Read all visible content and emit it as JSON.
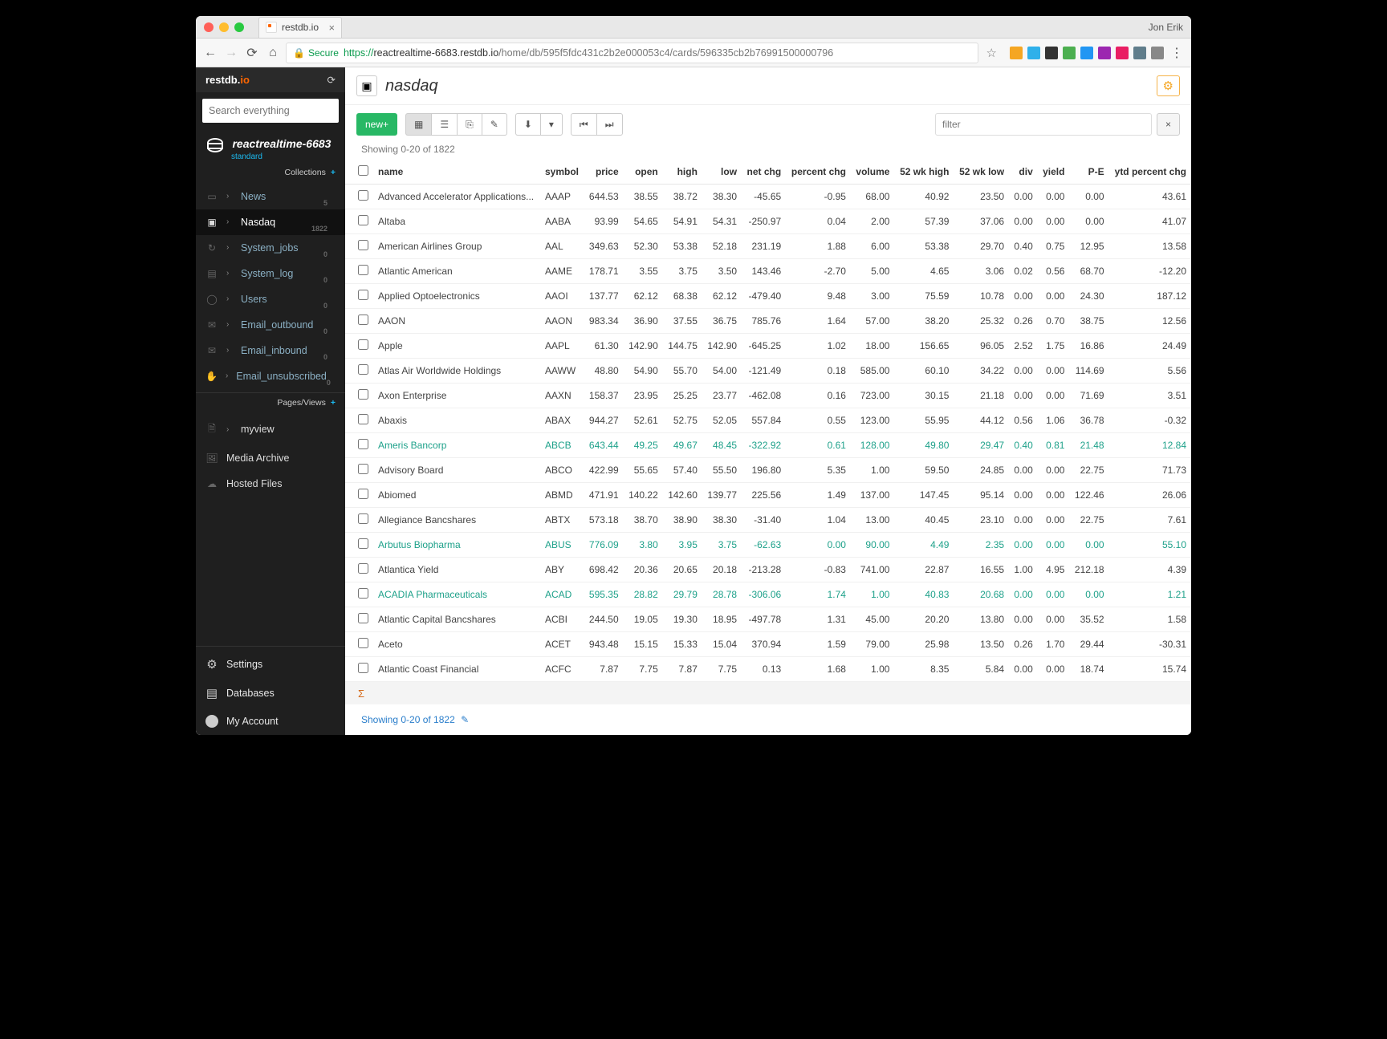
{
  "chrome": {
    "tab_title": "restdb.io",
    "user": "Jon Erik",
    "secure_label": "Secure",
    "https": "https://",
    "host": "reactrealtime-6683.restdb.io",
    "path": "/home/db/595f5fdc431c2b2e000053c4/cards/596335cb2b76991500000796",
    "ext_colors": [
      "#f5a623",
      "#2fb0ea",
      "#333",
      "#4caf50",
      "#2196f3",
      "#9c27b0",
      "#e91e63",
      "#607d8b",
      "#888"
    ]
  },
  "sidebar": {
    "logo_main": "restdb.io",
    "search_placeholder": "Search everything",
    "db_name": "reactrealtime-6683",
    "db_sub": "standard",
    "collections_label": "Collections",
    "pages_label": "Pages/Views",
    "items": [
      {
        "label": "News",
        "count": "5"
      },
      {
        "label": "Nasdaq",
        "count": "1822"
      },
      {
        "label": "System_jobs",
        "count": "0"
      },
      {
        "label": "System_log",
        "count": "0"
      },
      {
        "label": "Users",
        "count": "0"
      },
      {
        "label": "Email_outbound",
        "count": "0"
      },
      {
        "label": "Email_inbound",
        "count": "0"
      },
      {
        "label": "Email_unsubscribed",
        "count": "0"
      }
    ],
    "myview_label": "myview",
    "media_label": "Media Archive",
    "hosted_label": "Hosted Files",
    "settings_label": "Settings",
    "databases_label": "Databases",
    "account_label": "My Account"
  },
  "main": {
    "title": "nasdaq",
    "new_label": "new",
    "filter_placeholder": "filter",
    "showing_label": "Showing 0-20 of 1822",
    "foot_showing": "Showing 0-20 of 1822",
    "columns": [
      "name",
      "symbol",
      "price",
      "open",
      "high",
      "low",
      "net chg",
      "percent chg",
      "volume",
      "52 wk high",
      "52 wk low",
      "div",
      "yield",
      "P-E",
      "ytd percent chg"
    ],
    "rows": [
      {
        "hl": false,
        "name": "Advanced Accelerator Applications...",
        "symbol": "AAAP",
        "price": "644.53",
        "open": "38.55",
        "high": "38.72",
        "low": "38.30",
        "net_chg": "-45.65",
        "percent_chg": "-0.95",
        "volume": "68.00",
        "wk_high": "40.92",
        "wk_low": "23.50",
        "div": "0.00",
        "yield": "0.00",
        "pe": "0.00",
        "ytd": "43.61"
      },
      {
        "hl": false,
        "name": "Altaba",
        "symbol": "AABA",
        "price": "93.99",
        "open": "54.65",
        "high": "54.91",
        "low": "54.31",
        "net_chg": "-250.97",
        "percent_chg": "0.04",
        "volume": "2.00",
        "wk_high": "57.39",
        "wk_low": "37.06",
        "div": "0.00",
        "yield": "0.00",
        "pe": "0.00",
        "ytd": "41.07"
      },
      {
        "hl": false,
        "name": "American Airlines Group",
        "symbol": "AAL",
        "price": "349.63",
        "open": "52.30",
        "high": "53.38",
        "low": "52.18",
        "net_chg": "231.19",
        "percent_chg": "1.88",
        "volume": "6.00",
        "wk_high": "53.38",
        "wk_low": "29.70",
        "div": "0.40",
        "yield": "0.75",
        "pe": "12.95",
        "ytd": "13.58"
      },
      {
        "hl": false,
        "name": "Atlantic American",
        "symbol": "AAME",
        "price": "178.71",
        "open": "3.55",
        "high": "3.75",
        "low": "3.50",
        "net_chg": "143.46",
        "percent_chg": "-2.70",
        "volume": "5.00",
        "wk_high": "4.65",
        "wk_low": "3.06",
        "div": "0.02",
        "yield": "0.56",
        "pe": "68.70",
        "ytd": "-12.20"
      },
      {
        "hl": false,
        "name": "Applied Optoelectronics",
        "symbol": "AAOI",
        "price": "137.77",
        "open": "62.12",
        "high": "68.38",
        "low": "62.12",
        "net_chg": "-479.40",
        "percent_chg": "9.48",
        "volume": "3.00",
        "wk_high": "75.59",
        "wk_low": "10.78",
        "div": "0.00",
        "yield": "0.00",
        "pe": "24.30",
        "ytd": "187.12"
      },
      {
        "hl": false,
        "name": "AAON",
        "symbol": "AAON",
        "price": "983.34",
        "open": "36.90",
        "high": "37.55",
        "low": "36.75",
        "net_chg": "785.76",
        "percent_chg": "1.64",
        "volume": "57.00",
        "wk_high": "38.20",
        "wk_low": "25.32",
        "div": "0.26",
        "yield": "0.70",
        "pe": "38.75",
        "ytd": "12.56"
      },
      {
        "hl": false,
        "name": "Apple",
        "symbol": "AAPL",
        "price": "61.30",
        "open": "142.90",
        "high": "144.75",
        "low": "142.90",
        "net_chg": "-645.25",
        "percent_chg": "1.02",
        "volume": "18.00",
        "wk_high": "156.65",
        "wk_low": "96.05",
        "div": "2.52",
        "yield": "1.75",
        "pe": "16.86",
        "ytd": "24.49"
      },
      {
        "hl": false,
        "name": "Atlas Air Worldwide Holdings",
        "symbol": "AAWW",
        "price": "48.80",
        "open": "54.90",
        "high": "55.70",
        "low": "54.00",
        "net_chg": "-121.49",
        "percent_chg": "0.18",
        "volume": "585.00",
        "wk_high": "60.10",
        "wk_low": "34.22",
        "div": "0.00",
        "yield": "0.00",
        "pe": "114.69",
        "ytd": "5.56"
      },
      {
        "hl": false,
        "name": "Axon Enterprise",
        "symbol": "AAXN",
        "price": "158.37",
        "open": "23.95",
        "high": "25.25",
        "low": "23.77",
        "net_chg": "-462.08",
        "percent_chg": "0.16",
        "volume": "723.00",
        "wk_high": "30.15",
        "wk_low": "21.18",
        "div": "0.00",
        "yield": "0.00",
        "pe": "71.69",
        "ytd": "3.51"
      },
      {
        "hl": false,
        "name": "Abaxis",
        "symbol": "ABAX",
        "price": "944.27",
        "open": "52.61",
        "high": "52.75",
        "low": "52.05",
        "net_chg": "557.84",
        "percent_chg": "0.55",
        "volume": "123.00",
        "wk_high": "55.95",
        "wk_low": "44.12",
        "div": "0.56",
        "yield": "1.06",
        "pe": "36.78",
        "ytd": "-0.32"
      },
      {
        "hl": true,
        "name": "Ameris Bancorp",
        "symbol": "ABCB",
        "price": "643.44",
        "open": "49.25",
        "high": "49.67",
        "low": "48.45",
        "net_chg": "-322.92",
        "percent_chg": "0.61",
        "volume": "128.00",
        "wk_high": "49.80",
        "wk_low": "29.47",
        "div": "0.40",
        "yield": "0.81",
        "pe": "21.48",
        "ytd": "12.84"
      },
      {
        "hl": false,
        "name": "Advisory Board",
        "symbol": "ABCO",
        "price": "422.99",
        "open": "55.65",
        "high": "57.40",
        "low": "55.50",
        "net_chg": "196.80",
        "percent_chg": "5.35",
        "volume": "1.00",
        "wk_high": "59.50",
        "wk_low": "24.85",
        "div": "0.00",
        "yield": "0.00",
        "pe": "22.75",
        "ytd": "71.73"
      },
      {
        "hl": false,
        "name": "Abiomed",
        "symbol": "ABMD",
        "price": "471.91",
        "open": "140.22",
        "high": "142.60",
        "low": "139.77",
        "net_chg": "225.56",
        "percent_chg": "1.49",
        "volume": "137.00",
        "wk_high": "147.45",
        "wk_low": "95.14",
        "div": "0.00",
        "yield": "0.00",
        "pe": "122.46",
        "ytd": "26.06"
      },
      {
        "hl": false,
        "name": "Allegiance Bancshares",
        "symbol": "ABTX",
        "price": "573.18",
        "open": "38.70",
        "high": "38.90",
        "low": "38.30",
        "net_chg": "-31.40",
        "percent_chg": "1.04",
        "volume": "13.00",
        "wk_high": "40.45",
        "wk_low": "23.10",
        "div": "0.00",
        "yield": "0.00",
        "pe": "22.75",
        "ytd": "7.61"
      },
      {
        "hl": true,
        "name": "Arbutus Biopharma",
        "symbol": "ABUS",
        "price": "776.09",
        "open": "3.80",
        "high": "3.95",
        "low": "3.75",
        "net_chg": "-62.63",
        "percent_chg": "0.00",
        "volume": "90.00",
        "wk_high": "4.49",
        "wk_low": "2.35",
        "div": "0.00",
        "yield": "0.00",
        "pe": "0.00",
        "ytd": "55.10"
      },
      {
        "hl": false,
        "name": "Atlantica Yield",
        "symbol": "ABY",
        "price": "698.42",
        "open": "20.36",
        "high": "20.65",
        "low": "20.18",
        "net_chg": "-213.28",
        "percent_chg": "-0.83",
        "volume": "741.00",
        "wk_high": "22.87",
        "wk_low": "16.55",
        "div": "1.00",
        "yield": "4.95",
        "pe": "212.18",
        "ytd": "4.39"
      },
      {
        "hl": true,
        "name": "ACADIA Pharmaceuticals",
        "symbol": "ACAD",
        "price": "595.35",
        "open": "28.82",
        "high": "29.79",
        "low": "28.78",
        "net_chg": "-306.06",
        "percent_chg": "1.74",
        "volume": "1.00",
        "wk_high": "40.83",
        "wk_low": "20.68",
        "div": "0.00",
        "yield": "0.00",
        "pe": "0.00",
        "ytd": "1.21"
      },
      {
        "hl": false,
        "name": "Atlantic Capital Bancshares",
        "symbol": "ACBI",
        "price": "244.50",
        "open": "19.05",
        "high": "19.30",
        "low": "18.95",
        "net_chg": "-497.78",
        "percent_chg": "1.31",
        "volume": "45.00",
        "wk_high": "20.20",
        "wk_low": "13.80",
        "div": "0.00",
        "yield": "0.00",
        "pe": "35.52",
        "ytd": "1.58"
      },
      {
        "hl": false,
        "name": "Aceto",
        "symbol": "ACET",
        "price": "943.48",
        "open": "15.15",
        "high": "15.33",
        "low": "15.04",
        "net_chg": "370.94",
        "percent_chg": "1.59",
        "volume": "79.00",
        "wk_high": "25.98",
        "wk_low": "13.50",
        "div": "0.26",
        "yield": "1.70",
        "pe": "29.44",
        "ytd": "-30.31"
      },
      {
        "hl": false,
        "name": "Atlantic Coast Financial",
        "symbol": "ACFC",
        "price": "7.87",
        "open": "7.75",
        "high": "7.87",
        "low": "7.75",
        "net_chg": "0.13",
        "percent_chg": "1.68",
        "volume": "1.00",
        "wk_high": "8.35",
        "wk_low": "5.84",
        "div": "0.00",
        "yield": "0.00",
        "pe": "18.74",
        "ytd": "15.74"
      }
    ],
    "sum": "Σ"
  }
}
